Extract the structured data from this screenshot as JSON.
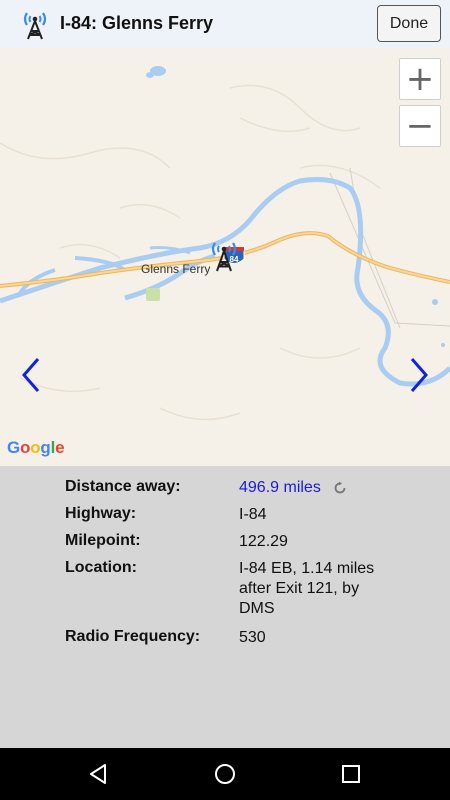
{
  "header": {
    "title": "I-84: Glenns Ferry",
    "done_label": "Done",
    "icon": "radio-tower-icon"
  },
  "map": {
    "zoom_in_label": "+",
    "zoom_out_label": "−",
    "place_label": "Glenns Ferry",
    "highway_shield": "84",
    "prev_icon": "chevron-left-icon",
    "next_icon": "chevron-right-icon",
    "attribution": {
      "g1": "G",
      "o1": "o",
      "o2": "o",
      "g2": "g",
      "l": "l",
      "e": "e"
    }
  },
  "details": {
    "distance": {
      "label": "Distance away:",
      "value": "496.9 miles"
    },
    "highway": {
      "label": "Highway:",
      "value": "I-84"
    },
    "milepoint": {
      "label": "Milepoint:",
      "value": "122.29"
    },
    "location": {
      "label": "Location:",
      "value": "I-84 EB, 1.14 miles after Exit 121, by DMS"
    },
    "frequency": {
      "label": "Radio Frequency:",
      "value": "530"
    }
  },
  "navbar": {
    "back_icon": "back-triangle-icon",
    "home_icon": "home-circle-icon",
    "recents_icon": "recents-square-icon"
  },
  "colors": {
    "accent": "#1a1ad9",
    "header_bg": "#eef3f9",
    "panel_bg": "#d6d6d6",
    "river": "#a9cdf2",
    "highway": "#f6c275"
  }
}
